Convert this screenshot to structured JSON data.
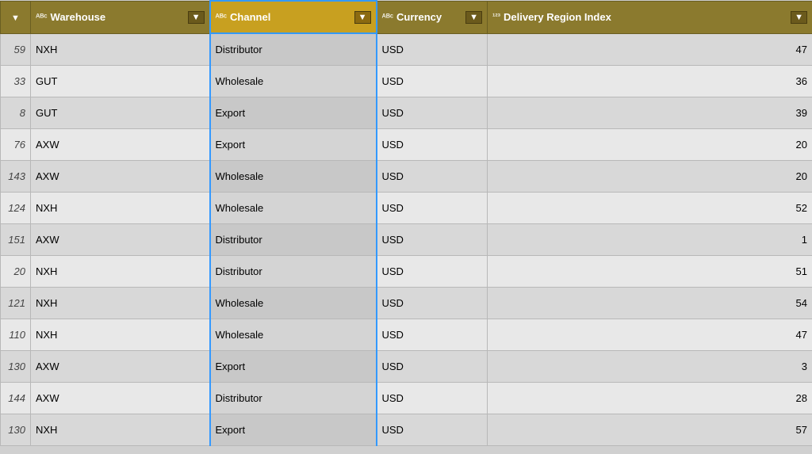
{
  "columns": {
    "index": {
      "label": ""
    },
    "warehouse": {
      "label": "Warehouse",
      "icon": "abc",
      "filter": true
    },
    "channel": {
      "label": "Channel",
      "icon": "abc",
      "filter": true
    },
    "currency": {
      "label": "Currency",
      "icon": "abc",
      "filter": true
    },
    "delivery": {
      "label": "Delivery Region Index",
      "icon": "num",
      "filter": true
    }
  },
  "rows": [
    {
      "index": "59",
      "warehouse": "NXH",
      "channel": "Distributor",
      "currency": "USD",
      "delivery": "47"
    },
    {
      "index": "33",
      "warehouse": "GUT",
      "channel": "Wholesale",
      "currency": "USD",
      "delivery": "36"
    },
    {
      "index": "8",
      "warehouse": "GUT",
      "channel": "Export",
      "currency": "USD",
      "delivery": "39"
    },
    {
      "index": "76",
      "warehouse": "AXW",
      "channel": "Export",
      "currency": "USD",
      "delivery": "20"
    },
    {
      "index": "143",
      "warehouse": "AXW",
      "channel": "Wholesale",
      "currency": "USD",
      "delivery": "20"
    },
    {
      "index": "124",
      "warehouse": "NXH",
      "channel": "Wholesale",
      "currency": "USD",
      "delivery": "52"
    },
    {
      "index": "151",
      "warehouse": "AXW",
      "channel": "Distributor",
      "currency": "USD",
      "delivery": "1"
    },
    {
      "index": "20",
      "warehouse": "NXH",
      "channel": "Distributor",
      "currency": "USD",
      "delivery": "51"
    },
    {
      "index": "121",
      "warehouse": "NXH",
      "channel": "Wholesale",
      "currency": "USD",
      "delivery": "54"
    },
    {
      "index": "110",
      "warehouse": "NXH",
      "channel": "Wholesale",
      "currency": "USD",
      "delivery": "47"
    },
    {
      "index": "130",
      "warehouse": "AXW",
      "channel": "Export",
      "currency": "USD",
      "delivery": "3"
    },
    {
      "index": "144",
      "warehouse": "AXW",
      "channel": "Distributor",
      "currency": "USD",
      "delivery": "28"
    },
    {
      "index": "130",
      "warehouse": "NXH",
      "channel": "Export",
      "currency": "USD",
      "delivery": "57"
    }
  ],
  "icons": {
    "dropdown_arrow": "▼",
    "filter_arrow": "▾",
    "abc_label": "ᴬᴮᶜ",
    "num_label": "¹²³"
  }
}
